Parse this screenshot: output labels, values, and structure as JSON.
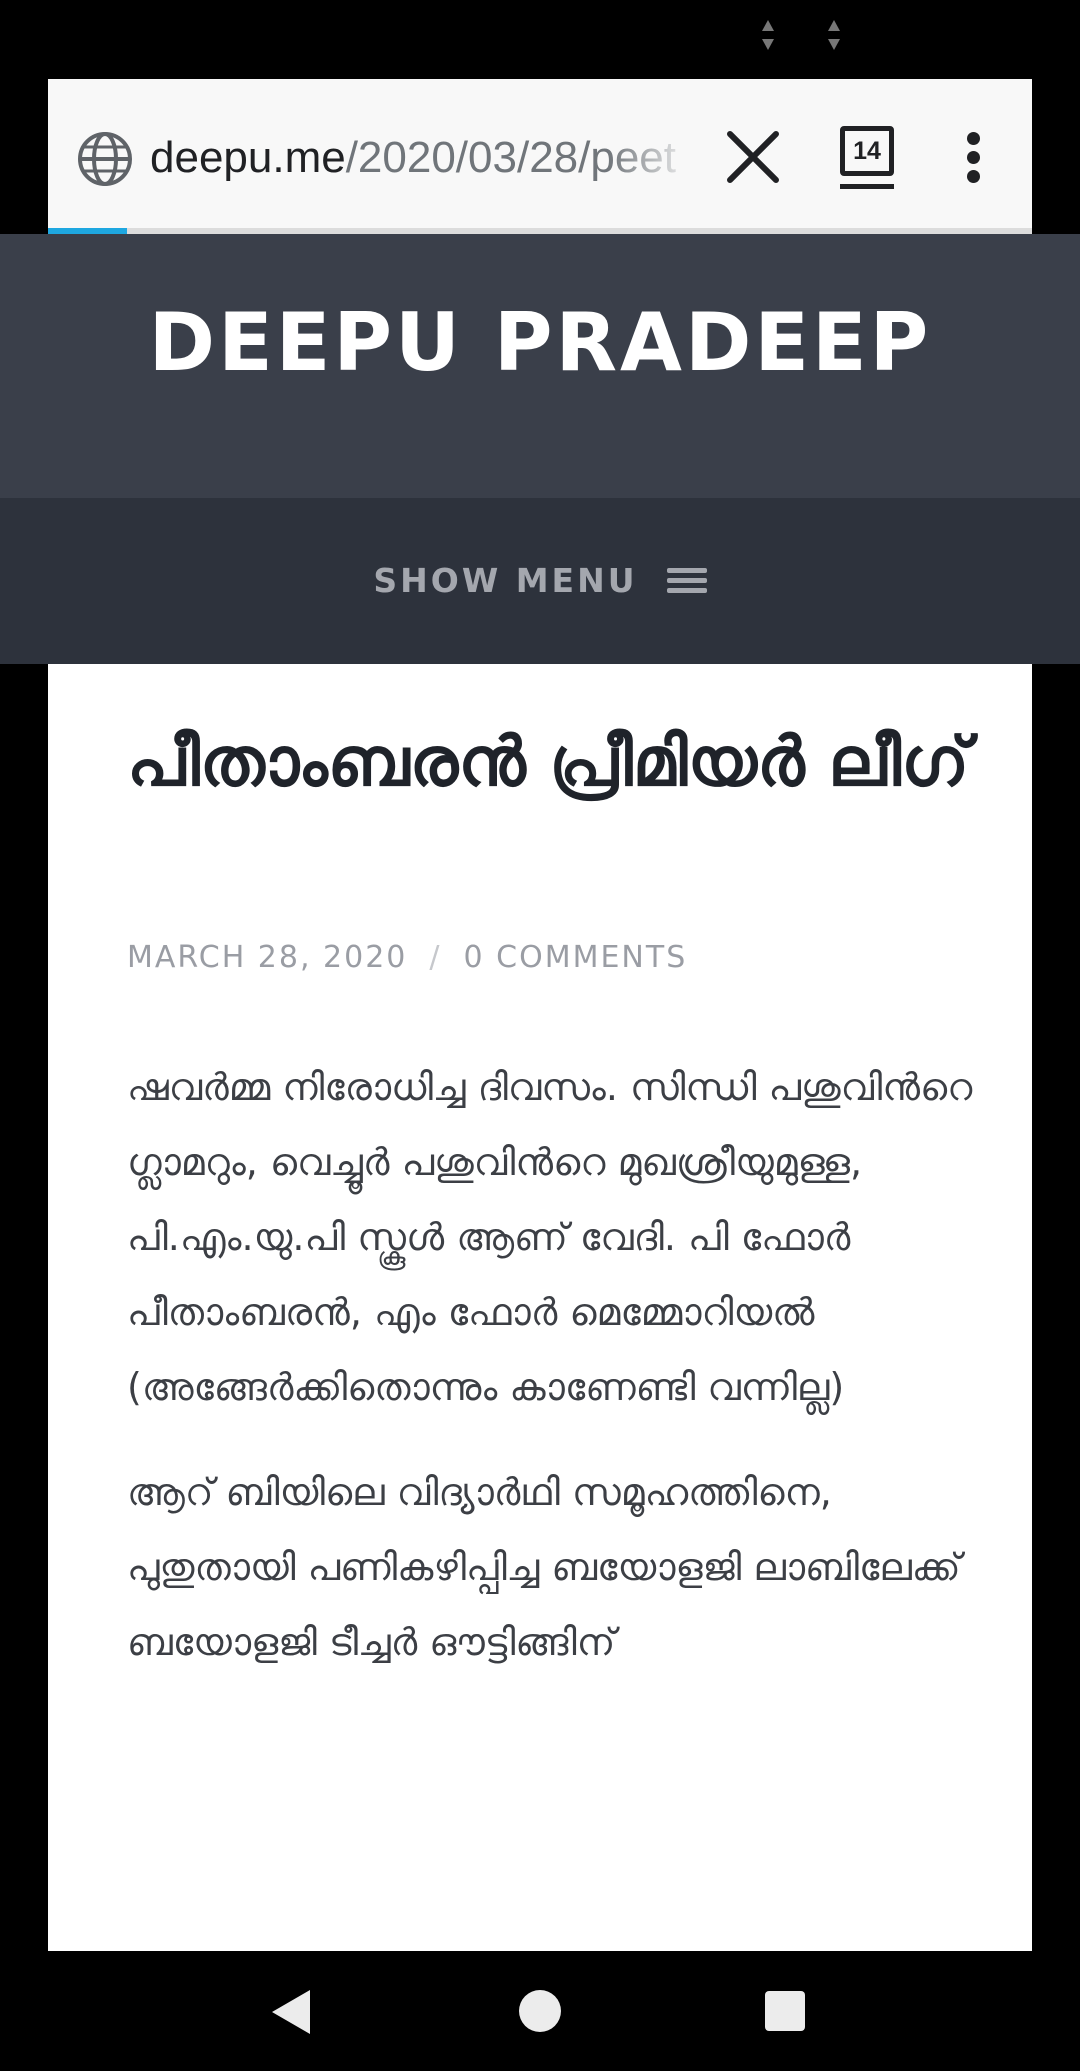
{
  "browser": {
    "url_domain": "deepu.me",
    "url_path": "/2020/03/28/peet",
    "tab_count": "14",
    "load_progress": 0.08
  },
  "site": {
    "title": "DEEPU PRADEEP",
    "menu_label": "SHOW MENU"
  },
  "post": {
    "title": "പീതാംബരൻ പ്രീമിയർ ലീഗ്",
    "date": "MARCH 28, 2020",
    "separator": "/",
    "comments": "0 COMMENTS",
    "paragraphs": [
      "ഷവർമ്മ നിരോധിച്ച ദിവസം. സിന്ധി പശുവിൻറെ ഗ്ലാമറും, വെച്ചൂർ പശുവിൻറെ മുഖശ്രീയുമുള്ള, പി.എം.യു.പി സ്കൂൾ ആണ് വേദി. പി ഫോർ പീതാംബരൻ, എം ഫോർ മെമ്മോറിയൽ (അങ്ങേർക്കിതൊന്നും കാണേണ്ടി വന്നില്ല)",
      "ആറ് ബിയിലെ വിദ്യാർഥി സമൂഹത്തിനെ, പുതുതായി പണികഴിപ്പിച്ച ബയോളജി ലാബിലേക്ക് ബയോളജി ടീച്ചർ ഔട്ടിങ്ങിന്"
    ]
  },
  "colors": {
    "header_bg": "#3a3f4a",
    "menu_bg": "#2d323c",
    "progress": "#1ea7e0"
  }
}
